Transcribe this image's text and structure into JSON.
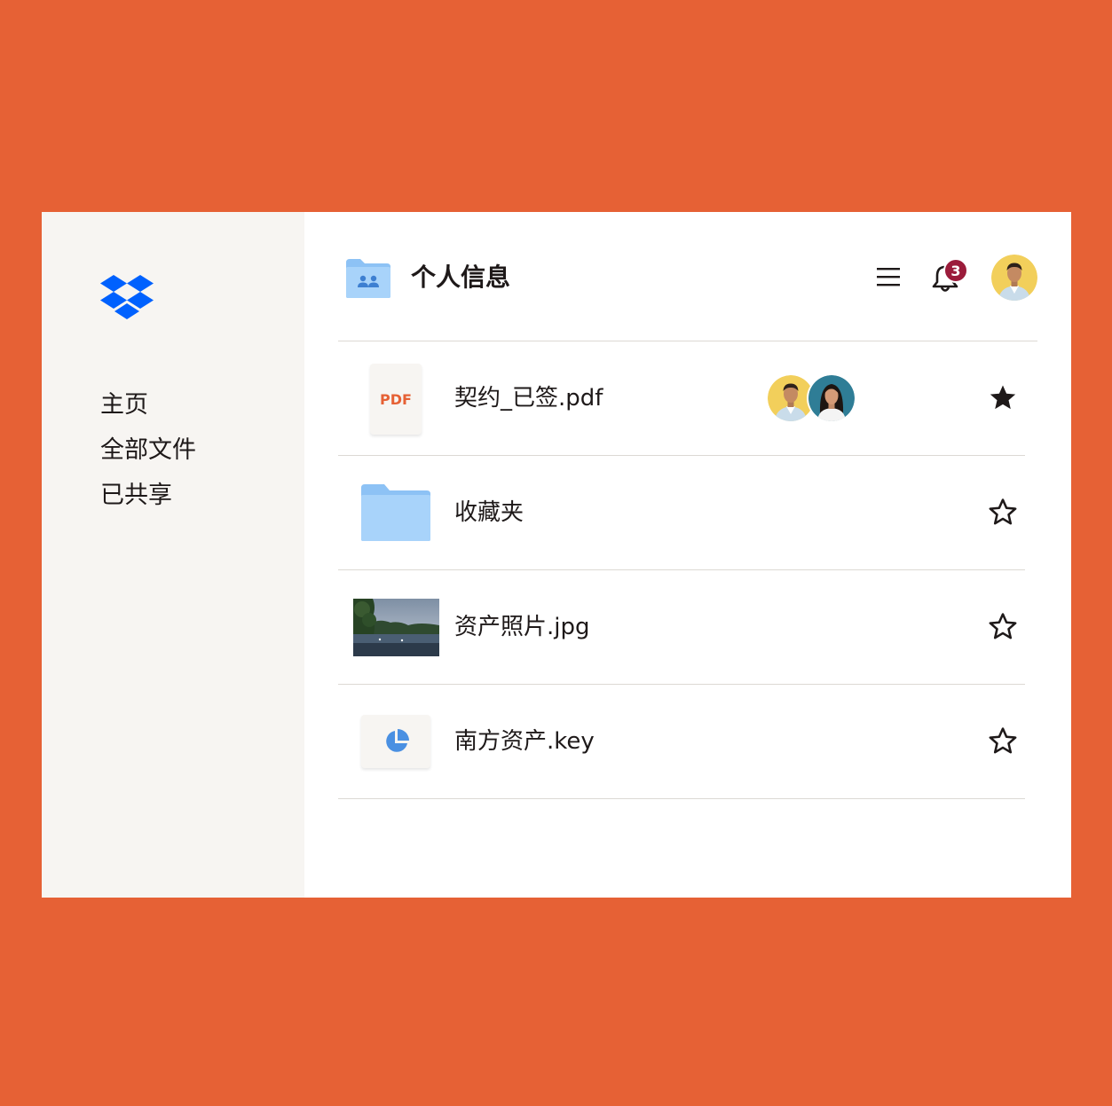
{
  "app": {
    "brand_color": "#0061fe",
    "background_color": "#e66135"
  },
  "sidebar": {
    "logo": "dropbox-logo",
    "items": [
      {
        "label": "主页"
      },
      {
        "label": "全部文件"
      },
      {
        "label": "已共享"
      }
    ]
  },
  "header": {
    "folder_icon": "shared-folder-icon",
    "title": "个人信息",
    "menu_icon": "hamburger-menu-icon",
    "notification_icon": "bell-icon",
    "notification_count": "3",
    "badge_color": "#9b1c3b",
    "avatar": "user-avatar"
  },
  "files": [
    {
      "name": "契约_已签.pdf",
      "icon": "pdf-file-icon",
      "icon_label": "PDF",
      "starred": true,
      "shared_with": [
        "man-avatar",
        "woman-avatar"
      ]
    },
    {
      "name": "收藏夹",
      "icon": "folder-icon",
      "starred": false
    },
    {
      "name": "资产照片.jpg",
      "icon": "image-thumbnail",
      "starred": false
    },
    {
      "name": "南方资产.key",
      "icon": "keynote-pie-chart-icon",
      "starred": false
    }
  ]
}
